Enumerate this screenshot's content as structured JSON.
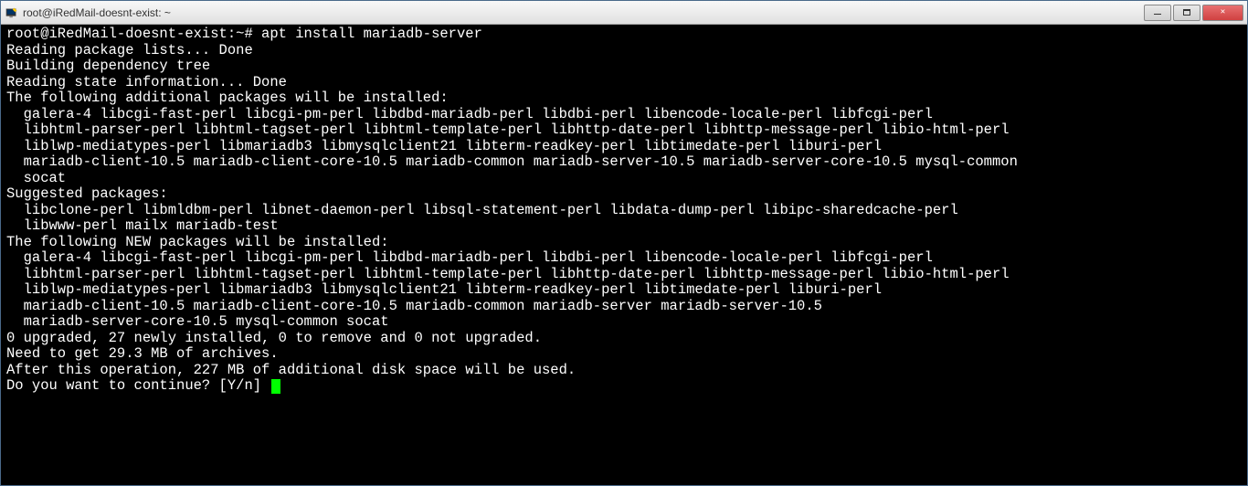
{
  "titlebar": {
    "title": "root@iRedMail-doesnt-exist: ~"
  },
  "terminal": {
    "prompt": "root@iRedMail-doesnt-exist:~# ",
    "command": "apt install mariadb-server",
    "lines": [
      "Reading package lists... Done",
      "Building dependency tree",
      "Reading state information... Done",
      "The following additional packages will be installed:",
      "  galera-4 libcgi-fast-perl libcgi-pm-perl libdbd-mariadb-perl libdbi-perl libencode-locale-perl libfcgi-perl",
      "  libhtml-parser-perl libhtml-tagset-perl libhtml-template-perl libhttp-date-perl libhttp-message-perl libio-html-perl",
      "  liblwp-mediatypes-perl libmariadb3 libmysqlclient21 libterm-readkey-perl libtimedate-perl liburi-perl",
      "  mariadb-client-10.5 mariadb-client-core-10.5 mariadb-common mariadb-server-10.5 mariadb-server-core-10.5 mysql-common",
      "  socat",
      "Suggested packages:",
      "  libclone-perl libmldbm-perl libnet-daemon-perl libsql-statement-perl libdata-dump-perl libipc-sharedcache-perl",
      "  libwww-perl mailx mariadb-test",
      "The following NEW packages will be installed:",
      "  galera-4 libcgi-fast-perl libcgi-pm-perl libdbd-mariadb-perl libdbi-perl libencode-locale-perl libfcgi-perl",
      "  libhtml-parser-perl libhtml-tagset-perl libhtml-template-perl libhttp-date-perl libhttp-message-perl libio-html-perl",
      "  liblwp-mediatypes-perl libmariadb3 libmysqlclient21 libterm-readkey-perl libtimedate-perl liburi-perl",
      "  mariadb-client-10.5 mariadb-client-core-10.5 mariadb-common mariadb-server mariadb-server-10.5",
      "  mariadb-server-core-10.5 mysql-common socat",
      "0 upgraded, 27 newly installed, 0 to remove and 0 not upgraded.",
      "Need to get 29.3 MB of archives.",
      "After this operation, 227 MB of additional disk space will be used.",
      "Do you want to continue? [Y/n] "
    ]
  }
}
